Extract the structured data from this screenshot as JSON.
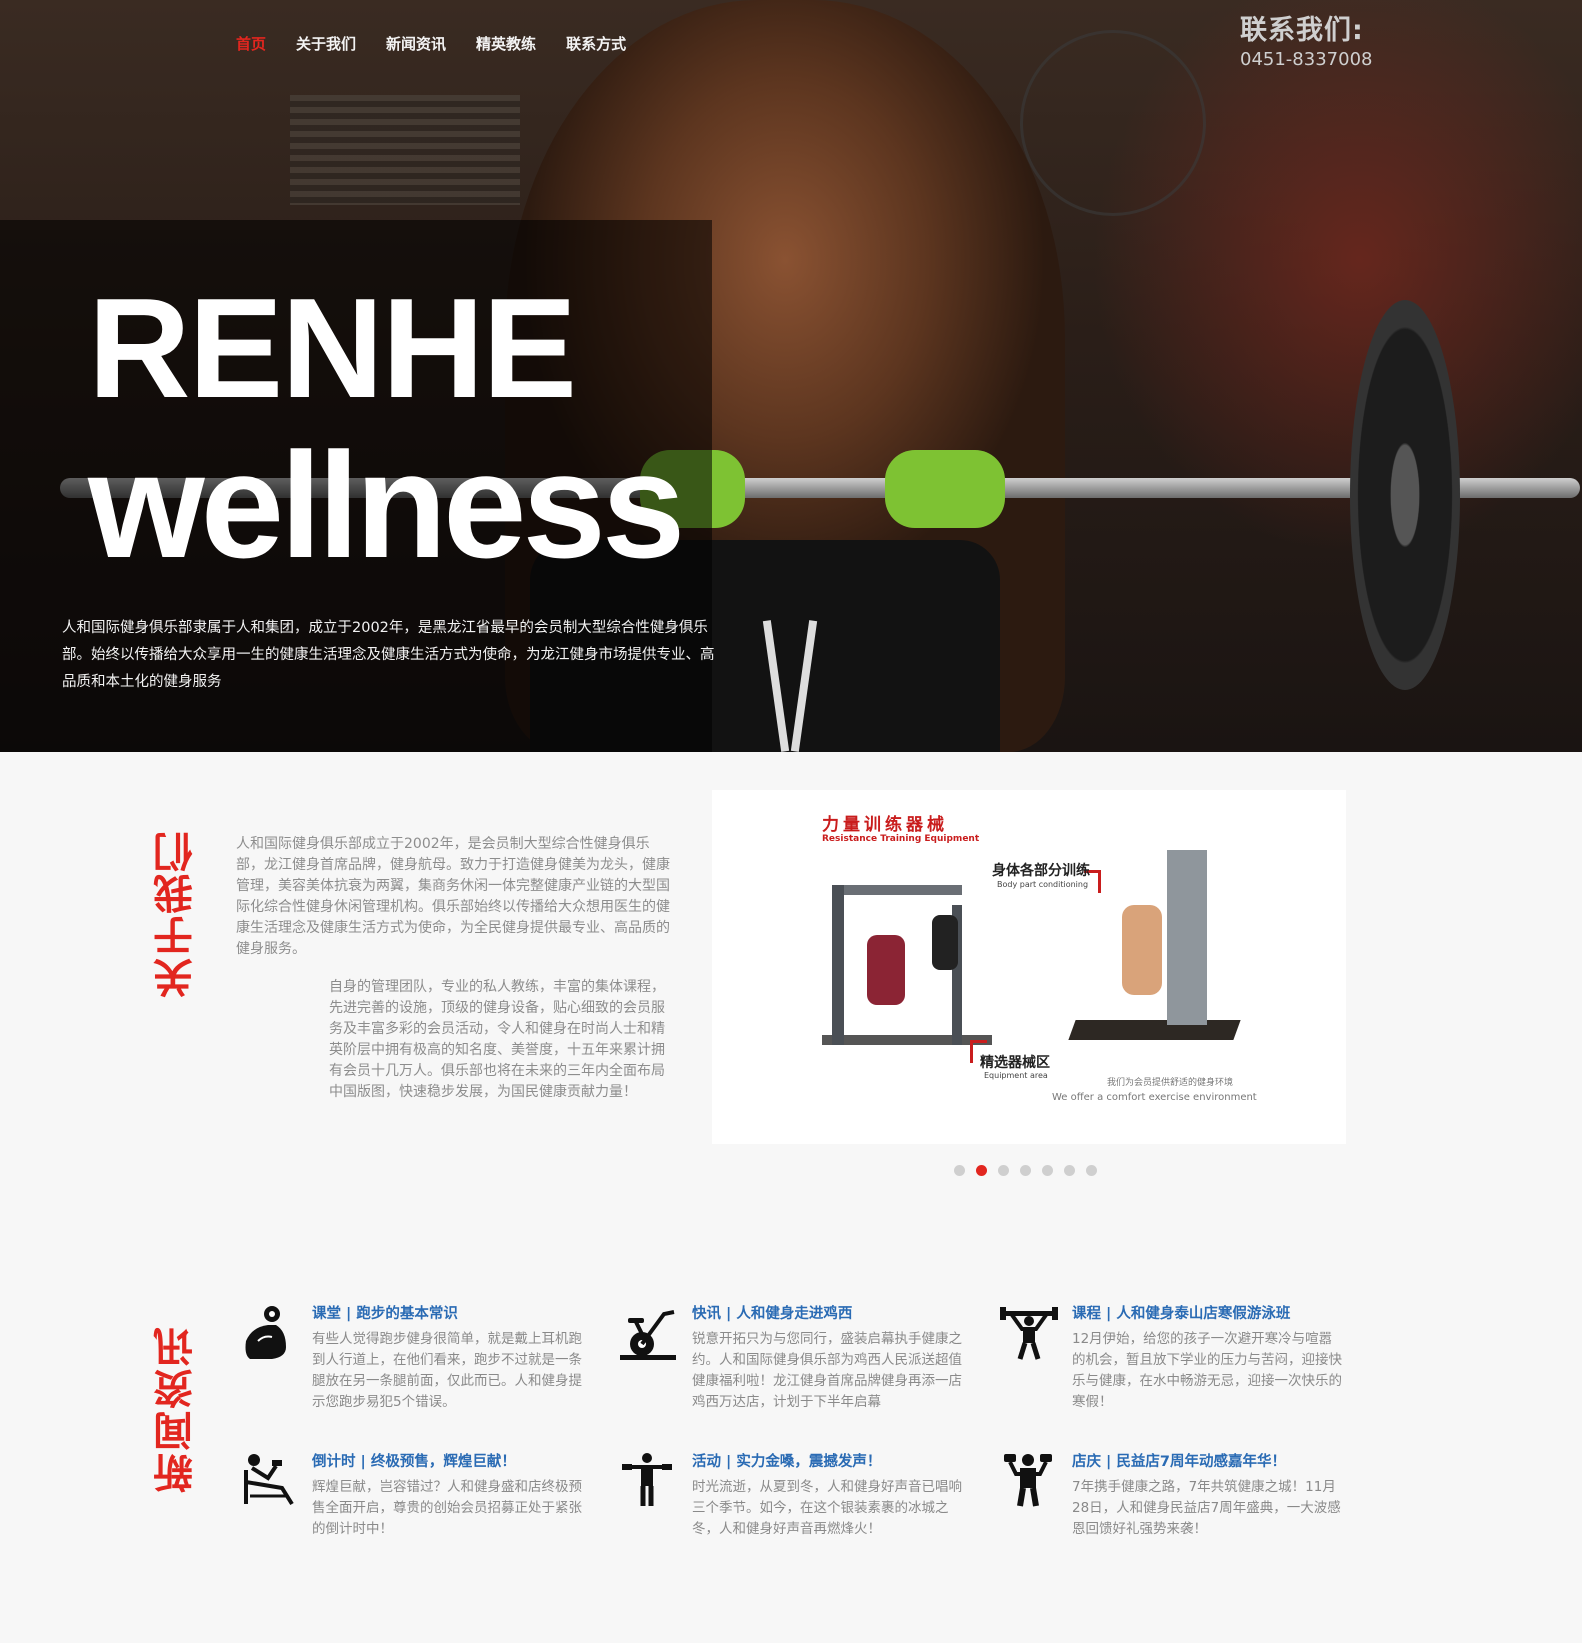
{
  "nav": {
    "items": [
      "首页",
      "关于我们",
      "新闻资讯",
      "精英教练",
      "联系方式"
    ],
    "active_index": 0
  },
  "header_contact": {
    "label": "联系我们:",
    "phone": "0451-8337008"
  },
  "hero": {
    "title_line1": "RENHE",
    "title_line2": "wellness",
    "description": "人和国际健身俱乐部隶属于人和集团，成立于2002年，是黑龙江省最早的会员制大型综合性健身俱乐部。始终以传播给大众享用一生的健康生活理念及健康生活方式为使命，为龙江健身市场提供专业、高品质和本土化的健身服务"
  },
  "about": {
    "title": "关于我们",
    "paragraph1": "人和国际健身俱乐部成立于2002年，是会员制大型综合性健身俱乐部，龙江健身首席品牌，健身航母。致力于打造健身健美为龙头，健康管理，美容美体抗衰为两翼，集商务休闲一体完整健康产业链的大型国际化综合性健身休闲管理机构。俱乐部始终以传播给大众想用医生的健康生活理念及健康生活方式为使命，为全民健身提供最专业、高品质的健身服务。",
    "paragraph2": "自身的管理团队，专业的私人教练，丰富的集体课程，先进完善的设施，顶级的健身设备，贴心细致的会员服务及丰富多彩的会员活动，令人和健身在时尚人士和精英阶层中拥有极高的知名度、美誉度，十五年来累计拥有会员十几万人。俱乐部也将在未来的三年内全面布局中国版图，快速稳步发展，为国民健康贡献力量！"
  },
  "slider": {
    "title": "力量训练器械",
    "subtitle": "Resistance Training Equipment",
    "tag1": "身体各部分训练",
    "tag1_sub": "Body part conditioning",
    "tag2": "精选器械区",
    "tag2_sub": "Equipment area",
    "footer_cn": "我们为会员提供舒适的健身环境",
    "footer_en": "We offer a comfort exercise environment",
    "dot_count": 7,
    "active_dot": 1
  },
  "news": {
    "title": "新闻资讯",
    "items": [
      {
        "icon": "flex-arm-icon",
        "headline": "课堂 | 跑步的基本常识",
        "text": "有些人觉得跑步健身很简单，就是戴上耳机跑到人行道上，在他们看来，跑步不过就是一条腿放在另一条腿前面，仅此而已。人和健身提示您跑步易犯5个错误。"
      },
      {
        "icon": "exercise-bike-icon",
        "headline": "快讯 | 人和健身走进鸡西",
        "text": "锐意开拓只为与您同行，盛装启幕执手健康之约。人和国际健身俱乐部为鸡西人民派送超值健康福利啦！龙江健身首席品牌健身再添一店鸡西万达店，计划于下半年启幕"
      },
      {
        "icon": "weightlifter-icon",
        "headline": "课程 | 人和健身泰山店寒假游泳班",
        "text": "12月伊始，给您的孩子一次避开寒冷与喧嚣的机会，暂且放下学业的压力与苦闷，迎接快乐与健康，在水中畅游无忌，迎接一次快乐的寒假！"
      },
      {
        "icon": "bench-press-icon",
        "headline": "倒计时 | 终极预售，辉煌巨献！",
        "text": "辉煌巨献，岂容错过？人和健身盛和店终极预售全面开启，尊贵的创始会员招募正处于紧张的倒计时中！"
      },
      {
        "icon": "dumbbell-raise-icon",
        "headline": "活动 | 实力金嗓，震撼发声！",
        "text": "时光流逝，从夏到冬，人和健身好声音已唱响三个季节。如今，在这个银装素裹的冰城之冬，人和健身好声音再燃烽火！"
      },
      {
        "icon": "dumbbell-man-icon",
        "headline": "店庆 | 民益店7周年动感嘉年华！",
        "text": "7年携手健康之路，7年共筑健康之城！11月28日，人和健身民益店7周年盛典，一大波感恩回馈好礼强势来袭！"
      }
    ]
  },
  "colors": {
    "accent": "#e2261f",
    "link": "#2a6bb4",
    "body_text": "#8a8a8a",
    "background": "#f7f7f7"
  }
}
